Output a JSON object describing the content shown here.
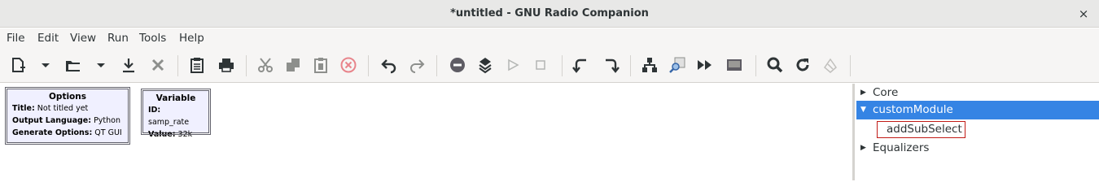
{
  "window": {
    "title": "*untitled - GNU Radio Companion",
    "close_glyph": "×"
  },
  "menubar": [
    "File",
    "Edit",
    "View",
    "Run",
    "Tools",
    "Help"
  ],
  "toolbar": {
    "icons": [
      "new-file-icon",
      "new-dropdown-icon",
      "open-file-icon",
      "open-dropdown-icon",
      "save-icon",
      "close-file-icon",
      "flowgraph-properties-icon",
      "print-icon",
      "cut-icon",
      "copy-icon",
      "paste-icon",
      "delete-icon",
      "undo-icon",
      "redo-icon",
      "disable-block-icon",
      "bypass-block-icon",
      "execute-icon",
      "stop-icon",
      "rotate-ccw-icon",
      "rotate-cw-icon",
      "hierarchy-icon",
      "find-block-icon",
      "generate-icon",
      "screen-capture-icon",
      "search-icon",
      "reload-icon",
      "clear-icon"
    ]
  },
  "canvas": {
    "options_block": {
      "title": "Options",
      "params": [
        {
          "label": "Title:",
          "value": " Not titled yet"
        },
        {
          "label": "Output Language:",
          "value": " Python"
        },
        {
          "label": "Generate Options:",
          "value": " QT GUI"
        }
      ]
    },
    "variable_block": {
      "title": "Variable",
      "params": [
        {
          "label": "ID:",
          "value": " samp_rate"
        },
        {
          "label": "Value:",
          "value": " 32k"
        }
      ]
    }
  },
  "block_tree": {
    "items": [
      {
        "label": "Core",
        "expanded": false,
        "selected": false
      },
      {
        "label": "customModule",
        "expanded": true,
        "selected": true,
        "children": [
          "addSubSelect"
        ]
      },
      {
        "label": "Equalizers",
        "expanded": false,
        "selected": false
      }
    ]
  },
  "colors": {
    "selection": "#3584e4",
    "block_fill": "#f0f0ff",
    "highlight_border": "#c11b17"
  }
}
